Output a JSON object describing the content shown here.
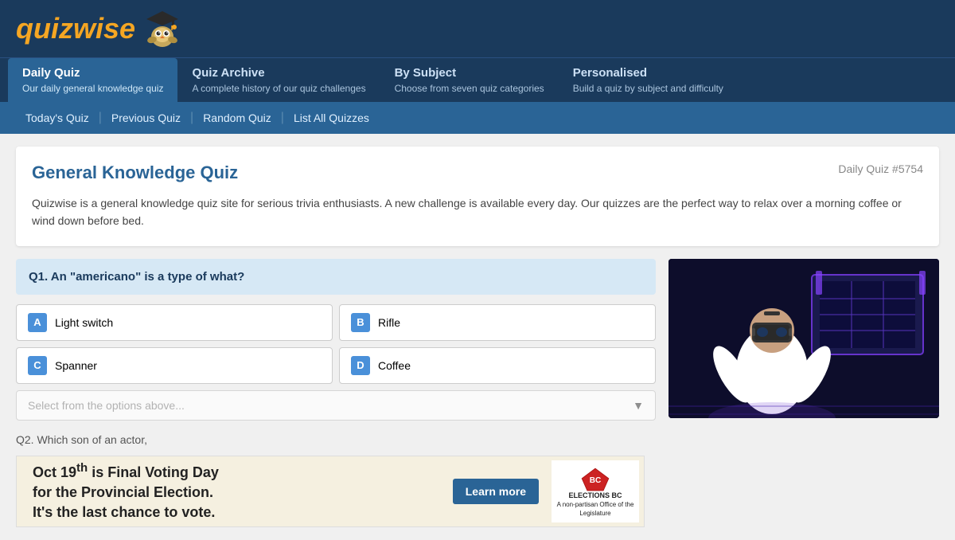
{
  "header": {
    "logo": "quizwise",
    "nav_tabs": [
      {
        "id": "daily",
        "title": "Daily Quiz",
        "desc": "Our daily general knowledge quiz",
        "active": true
      },
      {
        "id": "archive",
        "title": "Quiz Archive",
        "desc": "A complete history of our quiz challenges",
        "active": false
      },
      {
        "id": "subject",
        "title": "By Subject",
        "desc": "Choose from seven quiz categories",
        "active": false
      },
      {
        "id": "personalised",
        "title": "Personalised",
        "desc": "Build a quiz by subject and difficulty",
        "active": false
      }
    ],
    "sub_nav": [
      {
        "label": "Today's Quiz"
      },
      {
        "label": "Previous Quiz"
      },
      {
        "label": "Random Quiz"
      },
      {
        "label": "List All Quizzes"
      }
    ]
  },
  "quiz": {
    "title": "General Knowledge Quiz",
    "number": "Daily Quiz #5754",
    "description": "Quizwise is a general knowledge quiz site for serious trivia enthusiasts. A new challenge is available every day. Our quizzes are the perfect way to relax over a morning coffee or wind down before bed.",
    "question1": "Q1. An \"americano\" is a type of what?",
    "options": [
      {
        "letter": "A",
        "text": "Light switch"
      },
      {
        "letter": "B",
        "text": "Rifle"
      },
      {
        "letter": "C",
        "text": "Spanner"
      },
      {
        "letter": "D",
        "text": "Coffee"
      }
    ],
    "select_placeholder": "Select from the options above...",
    "question2_preview": "Q2. Which son of an actor,"
  },
  "banner": {
    "line1": "Oct 19",
    "superscript": "th",
    "line2": " is Final Voting Day",
    "line3": "for the Provincial Election.",
    "line4": "It's the last chance to vote.",
    "button_label": "Learn more",
    "elections_text": "ELECTIONS BC",
    "elections_sub": "A non-partisan Office of the Legislature"
  }
}
